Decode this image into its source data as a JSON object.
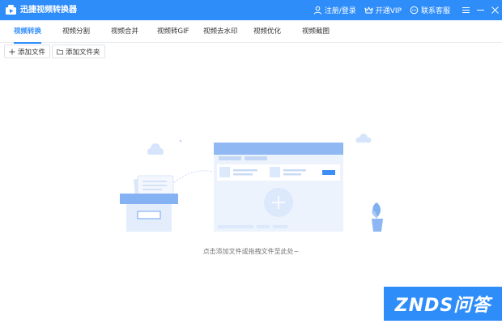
{
  "titlebar": {
    "app_title": "迅捷视频转换器",
    "login_label": "注册/登录",
    "vip_label": "开通VIP",
    "support_label": "联系客服"
  },
  "tabs": [
    {
      "label": "视频转换",
      "active": true
    },
    {
      "label": "视频分割",
      "active": false
    },
    {
      "label": "视频合并",
      "active": false
    },
    {
      "label": "视频转GIF",
      "active": false
    },
    {
      "label": "视频去水印",
      "active": false
    },
    {
      "label": "视频优化",
      "active": false
    },
    {
      "label": "视频截图",
      "active": false
    }
  ],
  "toolbar": {
    "add_file_label": "添加文件",
    "add_folder_label": "添加文件夹"
  },
  "dropzone": {
    "hint": "点击添加文件或拖拽文件至此处~"
  },
  "watermark": {
    "text": "ZNDS问答"
  },
  "colors": {
    "accent": "#2f8dfa",
    "illustration_light": "#e6effd",
    "illustration_mid": "#a8c6f3"
  }
}
